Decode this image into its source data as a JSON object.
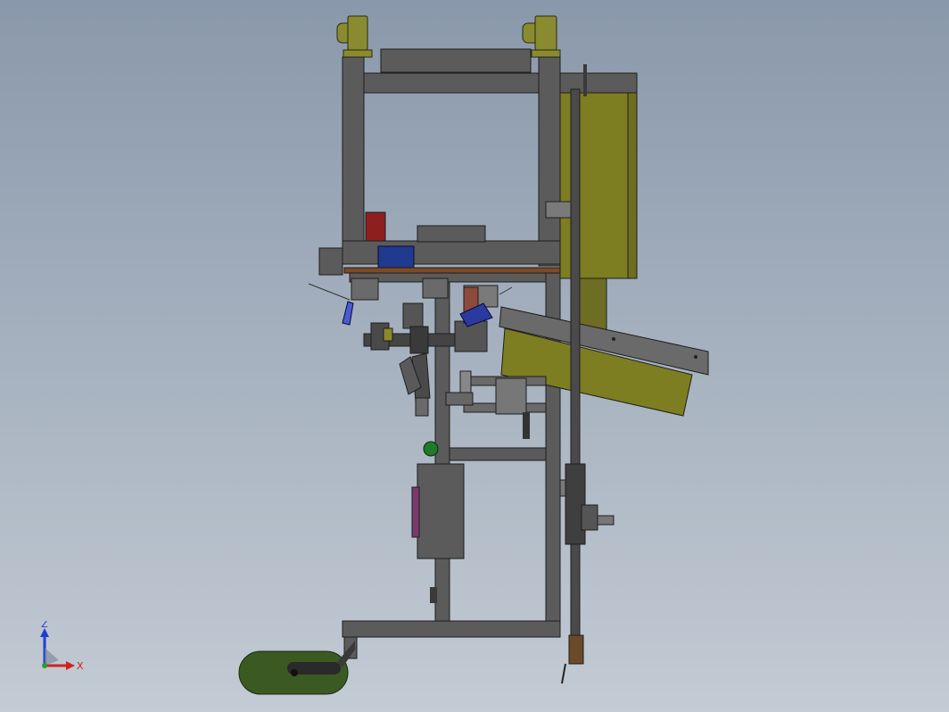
{
  "viewport": {
    "background_top": "#8a98ab",
    "background_bottom": "#c3cbd4"
  },
  "model": {
    "frame_color": "#5b5b5b",
    "frame_edge": "#1e1e1e",
    "panel_color": "#7d7d22",
    "accent_blue": "#1f3a8f",
    "accent_red": "#8e1f1f",
    "accent_brown": "#7a4a2a",
    "accent_green": "#1f7a2a",
    "accent_purple": "#7a3a6a",
    "tank_color": "#3a5a22"
  },
  "triad": {
    "z_label": "Z",
    "x_label": "X",
    "z_color": "#1f3fd0",
    "x_color": "#d02020",
    "y_color": "#20a030",
    "icon": "view-orientation-triad-icon"
  }
}
